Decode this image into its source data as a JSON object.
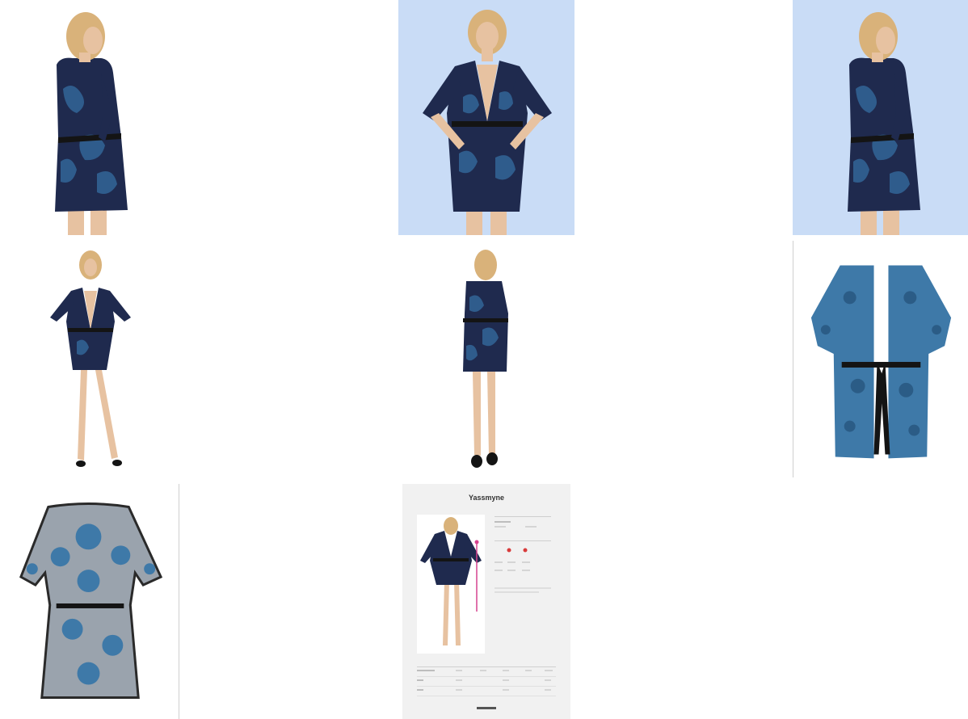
{
  "gallery": {
    "tiles": [
      {
        "name": "model-back-view-white",
        "background": "#ffffff"
      },
      {
        "name": "model-front-view-blue",
        "background": "#c9dcf6"
      },
      {
        "name": "model-back-view-blue",
        "background": "#c9dcf6"
      },
      {
        "name": "model-full-front-white",
        "background": "#ffffff"
      },
      {
        "name": "model-full-back-white",
        "background": "#ffffff"
      },
      {
        "name": "product-front-flat",
        "background": "#ffffff"
      },
      {
        "name": "product-back-flat",
        "background": "#ffffff"
      },
      {
        "name": "size-chart-card",
        "background": "#f1f1f1"
      }
    ],
    "size_card": {
      "title": "Yassmyne",
      "subtitle": ""
    }
  },
  "colors": {
    "lace_navy": "#1f2a4e",
    "lace_blue": "#2f5c8c",
    "flat_blue": "#3e79a8",
    "skin": "#e7c2a1",
    "hair": "#d9b27a",
    "belt": "#141414",
    "accent_pink": "#d6438f",
    "accent_red": "#d83a3a"
  }
}
